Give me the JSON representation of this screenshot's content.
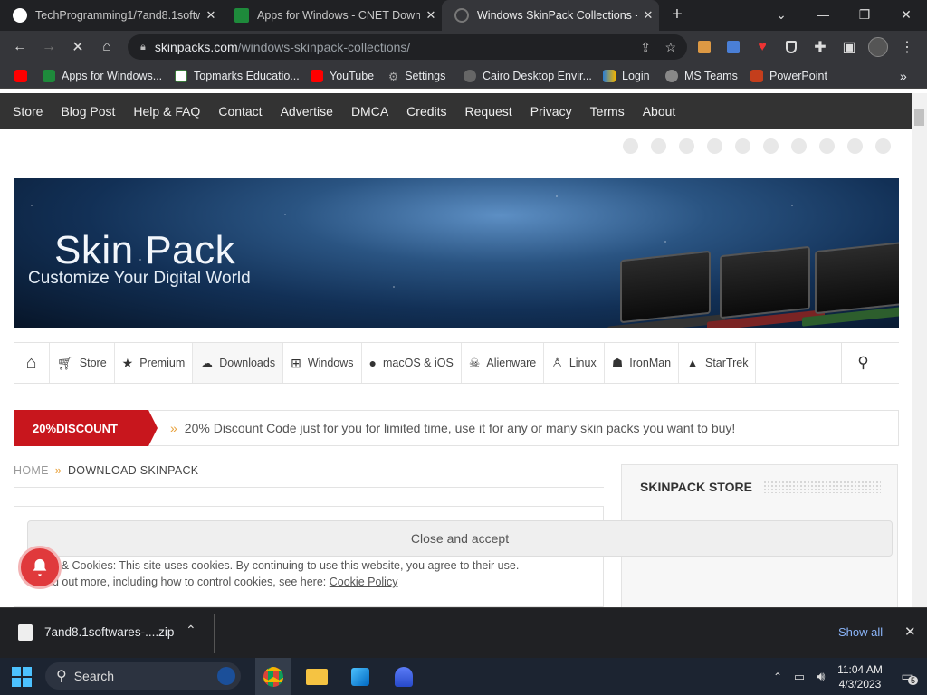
{
  "tabs": [
    {
      "title": "TechProgramming1/7and8.1softw",
      "fav_color": "#24292f"
    },
    {
      "title": "Apps for Windows - CNET Downl",
      "fav_color": "#1e8a3b"
    },
    {
      "title": "Windows SkinPack Collections - S",
      "fav_color": "#444"
    }
  ],
  "address": {
    "host": "skinpacks.com",
    "path": "/windows-skinpack-collections/"
  },
  "bookmarks": [
    {
      "label": "",
      "color": "#ff0000"
    },
    {
      "label": "Apps for Windows...",
      "color": "#1e8a3b"
    },
    {
      "label": "Topmarks Educatio...",
      "color": "#3a7d3a"
    },
    {
      "label": "YouTube",
      "color": "#ff0000"
    },
    {
      "label": "Settings",
      "color": "#aaa"
    },
    {
      "label": "Cairo Desktop Envir...",
      "color": "#666"
    },
    {
      "label": "Login",
      "color": "#2a7fd4"
    },
    {
      "label": "MS Teams",
      "color": "#888"
    },
    {
      "label": "PowerPoint",
      "color": "#c43e1c"
    }
  ],
  "topnav": [
    "Store",
    "Blog Post",
    "Help & FAQ",
    "Contact",
    "Advertise",
    "DMCA",
    "Credits",
    "Request",
    "Privacy",
    "Terms",
    "About"
  ],
  "banner": {
    "title": "Skin Pack",
    "subtitle": "Customize Your Digital World"
  },
  "categories": [
    {
      "label": "Store",
      "icon": "cart-icon"
    },
    {
      "label": "Premium",
      "icon": "star-icon"
    },
    {
      "label": "Downloads",
      "icon": "cloud-download-icon"
    },
    {
      "label": "Windows",
      "icon": "windows-icon"
    },
    {
      "label": "macOS & iOS",
      "icon": "apple-icon"
    },
    {
      "label": "Alienware",
      "icon": "alien-icon"
    },
    {
      "label": "Linux",
      "icon": "linux-icon"
    },
    {
      "label": "IronMan",
      "icon": "ironman-icon"
    },
    {
      "label": "StarTrek",
      "icon": "startrek-icon"
    }
  ],
  "discount": {
    "label": "20%DISCOUNT",
    "message": "20% Discount Code just for you for limited time, use it for any or many skin packs you want to buy!"
  },
  "breadcrumb": {
    "home": "HOME",
    "current": "DOWNLOAD SKINPACK"
  },
  "store_box": {
    "title": "SKINPACK STORE"
  },
  "cookie": {
    "button": "Close and accept",
    "line1": "y & Cookies: This site uses cookies. By continuing to use this website, you agree to their use.",
    "line2_prefix": "d out more, including how to control cookies, see here: ",
    "line2_link": "Cookie Policy"
  },
  "download": {
    "filename": "7and8.1softwares-....zip",
    "show_all": "Show all"
  },
  "taskbar": {
    "search": "Search",
    "time": "11:04 AM",
    "date": "4/3/2023",
    "notifications": "5"
  }
}
